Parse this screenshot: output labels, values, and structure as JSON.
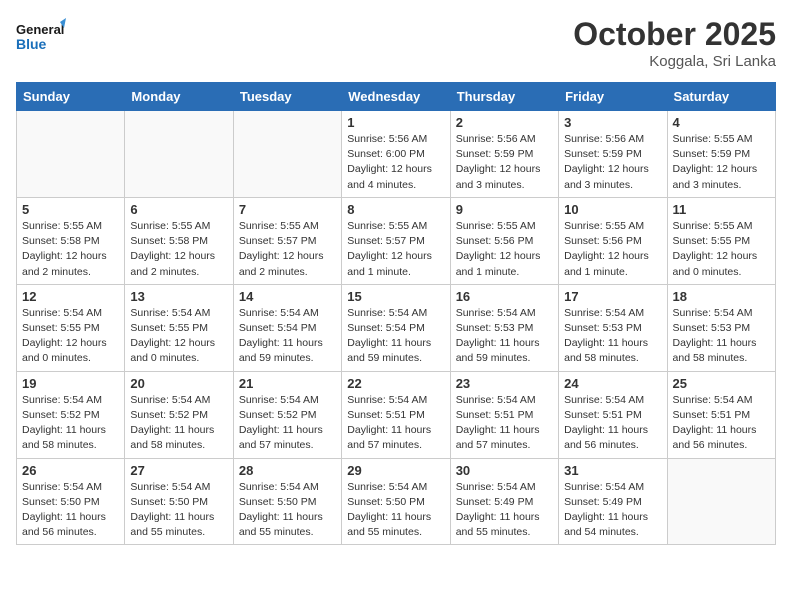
{
  "header": {
    "logo_line1": "General",
    "logo_line2": "Blue",
    "month": "October 2025",
    "location": "Koggala, Sri Lanka"
  },
  "weekdays": [
    "Sunday",
    "Monday",
    "Tuesday",
    "Wednesday",
    "Thursday",
    "Friday",
    "Saturday"
  ],
  "weeks": [
    [
      {
        "day": "",
        "detail": ""
      },
      {
        "day": "",
        "detail": ""
      },
      {
        "day": "",
        "detail": ""
      },
      {
        "day": "1",
        "detail": "Sunrise: 5:56 AM\nSunset: 6:00 PM\nDaylight: 12 hours\nand 4 minutes."
      },
      {
        "day": "2",
        "detail": "Sunrise: 5:56 AM\nSunset: 5:59 PM\nDaylight: 12 hours\nand 3 minutes."
      },
      {
        "day": "3",
        "detail": "Sunrise: 5:56 AM\nSunset: 5:59 PM\nDaylight: 12 hours\nand 3 minutes."
      },
      {
        "day": "4",
        "detail": "Sunrise: 5:55 AM\nSunset: 5:59 PM\nDaylight: 12 hours\nand 3 minutes."
      }
    ],
    [
      {
        "day": "5",
        "detail": "Sunrise: 5:55 AM\nSunset: 5:58 PM\nDaylight: 12 hours\nand 2 minutes."
      },
      {
        "day": "6",
        "detail": "Sunrise: 5:55 AM\nSunset: 5:58 PM\nDaylight: 12 hours\nand 2 minutes."
      },
      {
        "day": "7",
        "detail": "Sunrise: 5:55 AM\nSunset: 5:57 PM\nDaylight: 12 hours\nand 2 minutes."
      },
      {
        "day": "8",
        "detail": "Sunrise: 5:55 AM\nSunset: 5:57 PM\nDaylight: 12 hours\nand 1 minute."
      },
      {
        "day": "9",
        "detail": "Sunrise: 5:55 AM\nSunset: 5:56 PM\nDaylight: 12 hours\nand 1 minute."
      },
      {
        "day": "10",
        "detail": "Sunrise: 5:55 AM\nSunset: 5:56 PM\nDaylight: 12 hours\nand 1 minute."
      },
      {
        "day": "11",
        "detail": "Sunrise: 5:55 AM\nSunset: 5:55 PM\nDaylight: 12 hours\nand 0 minutes."
      }
    ],
    [
      {
        "day": "12",
        "detail": "Sunrise: 5:54 AM\nSunset: 5:55 PM\nDaylight: 12 hours\nand 0 minutes."
      },
      {
        "day": "13",
        "detail": "Sunrise: 5:54 AM\nSunset: 5:55 PM\nDaylight: 12 hours\nand 0 minutes."
      },
      {
        "day": "14",
        "detail": "Sunrise: 5:54 AM\nSunset: 5:54 PM\nDaylight: 11 hours\nand 59 minutes."
      },
      {
        "day": "15",
        "detail": "Sunrise: 5:54 AM\nSunset: 5:54 PM\nDaylight: 11 hours\nand 59 minutes."
      },
      {
        "day": "16",
        "detail": "Sunrise: 5:54 AM\nSunset: 5:53 PM\nDaylight: 11 hours\nand 59 minutes."
      },
      {
        "day": "17",
        "detail": "Sunrise: 5:54 AM\nSunset: 5:53 PM\nDaylight: 11 hours\nand 58 minutes."
      },
      {
        "day": "18",
        "detail": "Sunrise: 5:54 AM\nSunset: 5:53 PM\nDaylight: 11 hours\nand 58 minutes."
      }
    ],
    [
      {
        "day": "19",
        "detail": "Sunrise: 5:54 AM\nSunset: 5:52 PM\nDaylight: 11 hours\nand 58 minutes."
      },
      {
        "day": "20",
        "detail": "Sunrise: 5:54 AM\nSunset: 5:52 PM\nDaylight: 11 hours\nand 58 minutes."
      },
      {
        "day": "21",
        "detail": "Sunrise: 5:54 AM\nSunset: 5:52 PM\nDaylight: 11 hours\nand 57 minutes."
      },
      {
        "day": "22",
        "detail": "Sunrise: 5:54 AM\nSunset: 5:51 PM\nDaylight: 11 hours\nand 57 minutes."
      },
      {
        "day": "23",
        "detail": "Sunrise: 5:54 AM\nSunset: 5:51 PM\nDaylight: 11 hours\nand 57 minutes."
      },
      {
        "day": "24",
        "detail": "Sunrise: 5:54 AM\nSunset: 5:51 PM\nDaylight: 11 hours\nand 56 minutes."
      },
      {
        "day": "25",
        "detail": "Sunrise: 5:54 AM\nSunset: 5:51 PM\nDaylight: 11 hours\nand 56 minutes."
      }
    ],
    [
      {
        "day": "26",
        "detail": "Sunrise: 5:54 AM\nSunset: 5:50 PM\nDaylight: 11 hours\nand 56 minutes."
      },
      {
        "day": "27",
        "detail": "Sunrise: 5:54 AM\nSunset: 5:50 PM\nDaylight: 11 hours\nand 55 minutes."
      },
      {
        "day": "28",
        "detail": "Sunrise: 5:54 AM\nSunset: 5:50 PM\nDaylight: 11 hours\nand 55 minutes."
      },
      {
        "day": "29",
        "detail": "Sunrise: 5:54 AM\nSunset: 5:50 PM\nDaylight: 11 hours\nand 55 minutes."
      },
      {
        "day": "30",
        "detail": "Sunrise: 5:54 AM\nSunset: 5:49 PM\nDaylight: 11 hours\nand 55 minutes."
      },
      {
        "day": "31",
        "detail": "Sunrise: 5:54 AM\nSunset: 5:49 PM\nDaylight: 11 hours\nand 54 minutes."
      },
      {
        "day": "",
        "detail": ""
      }
    ]
  ]
}
